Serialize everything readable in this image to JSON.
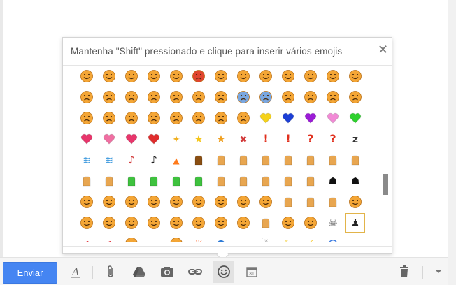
{
  "picker": {
    "title": "Mantenha \"Shift\" pressionado e clique para inserir vários emojis",
    "close_symbol": "✕",
    "selected_cell": 103,
    "emojis": [
      "smile",
      "smile",
      "grin",
      "smile",
      "smile",
      "angry-face",
      "kiss",
      "kiss",
      "kiss-blush",
      "smile",
      "grin",
      "smile",
      "tongue",
      "sad",
      "sad",
      "sad",
      "sad",
      "sad",
      "sad",
      "crying",
      "scared",
      "scared",
      "angry",
      "crying",
      "crying",
      "crying",
      "confounded",
      "spotted",
      "angry",
      "angry",
      "sad",
      "cry",
      "devil",
      "alien",
      "yellow-heart",
      "blue-heart",
      "purple-heart",
      "pink-heart",
      "green-heart",
      "heart",
      "broken-heart",
      "heart",
      "arrow-heart",
      "sparkle",
      "sparkle-star",
      "star",
      "anger",
      "exclamation",
      "exclamation",
      "question",
      "question",
      "zzz",
      "wind",
      "drops",
      "notes",
      "note",
      "fire",
      "poop",
      "thumbs-up",
      "thumbs-down",
      "ok-hand",
      "fist",
      "raised-fist",
      "peace",
      "pointing",
      "raised-hand",
      "open-hands",
      "ok-green",
      "hand-green",
      "hand-green",
      "hand-green",
      "hands",
      "hands",
      "fist",
      "clap",
      "muscle",
      "walking",
      "running",
      "couple",
      "dancer",
      "bunnies",
      "woman",
      "woman",
      "woman",
      "guard",
      "dancing",
      "woman",
      "hands",
      "hand",
      "pointing",
      "boy",
      "girl",
      "girl",
      "man",
      "baby",
      "grandpa",
      "old-man",
      "worker",
      "police",
      "hands",
      "angel",
      "lady",
      "skull",
      "footprints",
      "lips",
      "lips",
      "ear",
      "eyes",
      "nose",
      "sun",
      "umbrella",
      "cloud",
      "snowman",
      "moon",
      "lightning",
      "cyclone",
      "wave"
    ]
  },
  "toolbar": {
    "send_label": "Enviar"
  },
  "icons": {
    "format": "format-text-icon",
    "attach": "paperclip-icon",
    "drive": "drive-icon",
    "photo": "camera-icon",
    "link": "link-icon",
    "emoji": "emoji-icon",
    "calendar": "calendar-icon",
    "trash": "trash-icon",
    "more": "chevron-down-icon"
  },
  "colors": {
    "accent": "#4585f2",
    "emoji_face": "#f4a636",
    "selected_outline": "#e2b44a"
  }
}
